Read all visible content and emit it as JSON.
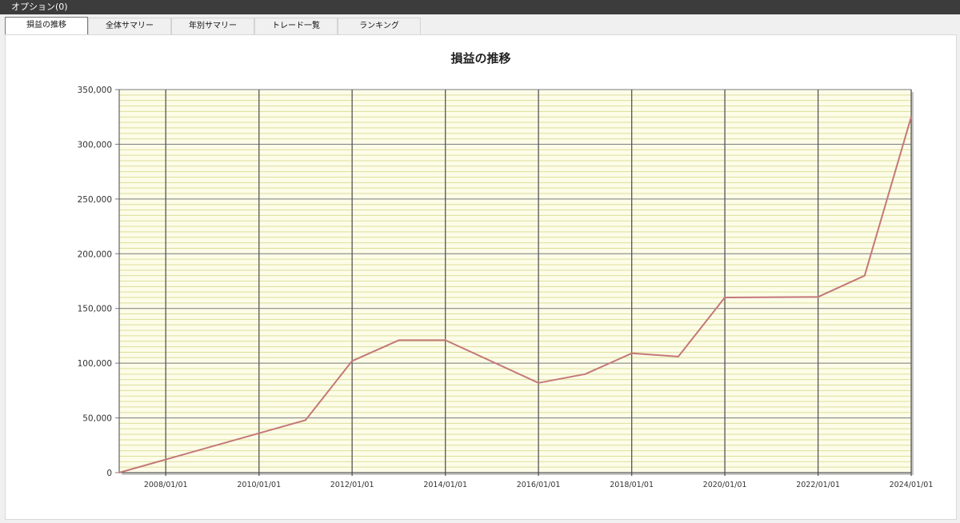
{
  "menu": {
    "title": "オプション(0)"
  },
  "tabs": [
    {
      "label": "損益の推移",
      "active": true
    },
    {
      "label": "全体サマリー",
      "active": false
    },
    {
      "label": "年別サマリー",
      "active": false
    },
    {
      "label": "トレード一覧",
      "active": false
    },
    {
      "label": "ランキング",
      "active": false
    }
  ],
  "colors": {
    "line": "#c47878",
    "plot_background": "#fcfce8",
    "minor_grid": "#dede9c",
    "major_grid": "#7a7a7a"
  },
  "chart_data": {
    "type": "line",
    "title": "損益の推移",
    "xlabel": "",
    "ylabel": "",
    "x_axis": {
      "type": "date",
      "range": [
        "2007-01-01",
        "2024-01-01"
      ],
      "ticks": [
        "2008/01/01",
        "2010/01/01",
        "2012/01/01",
        "2014/01/01",
        "2016/01/01",
        "2018/01/01",
        "2020/01/01",
        "2022/01/01",
        "2024/01/01"
      ]
    },
    "y_axis": {
      "range": [
        0,
        350000
      ],
      "major_step": 50000,
      "minor_step": 5000,
      "ticks": [
        "0",
        "50,000",
        "100,000",
        "150,000",
        "200,000",
        "250,000",
        "300,000",
        "350,000"
      ]
    },
    "grid": true,
    "legend": "none",
    "series": [
      {
        "x": [
          "2007-01-01",
          "2011-01-01",
          "2012-01-01",
          "2013-01-01",
          "2014-01-01",
          "2016-01-01",
          "2017-01-01",
          "2018-01-01",
          "2019-01-01",
          "2020-01-01",
          "2022-01-01",
          "2023-01-01",
          "2024-01-01"
        ],
        "y": [
          0,
          48000,
          102000,
          121000,
          121000,
          82000,
          90000,
          109000,
          106000,
          160000,
          160500,
          180000,
          325000
        ]
      }
    ]
  }
}
